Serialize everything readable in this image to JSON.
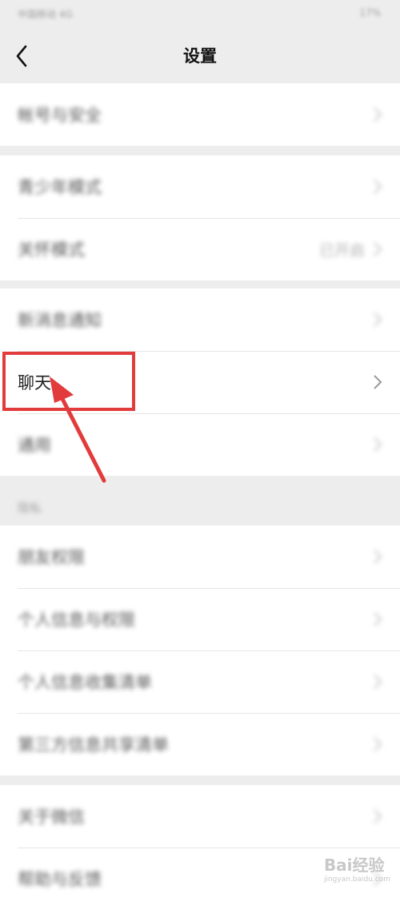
{
  "status_bar": {
    "carrier": "中国移动 4G",
    "battery": "17%"
  },
  "header": {
    "title": "设置"
  },
  "groups": [
    {
      "items": [
        {
          "label": "帐号与安全"
        }
      ]
    },
    {
      "items": [
        {
          "label": "青少年模式"
        },
        {
          "label": "关怀模式",
          "value": "已开启"
        }
      ]
    },
    {
      "items": [
        {
          "label": "新消息通知"
        },
        {
          "label": "聊天"
        },
        {
          "label": "通用"
        }
      ]
    },
    {
      "header": "隐私",
      "items": [
        {
          "label": "朋友权限"
        },
        {
          "label": "个人信息与权限"
        },
        {
          "label": "个人信息收集清单"
        },
        {
          "label": "第三方信息共享清单"
        }
      ]
    },
    {
      "items": [
        {
          "label": "关于微信"
        },
        {
          "label": "帮助与反馈"
        }
      ]
    }
  ],
  "icons": {
    "back": "chevron-left-icon",
    "row": "chevron-right-icon"
  },
  "colors": {
    "highlight": "#e23b3b",
    "background": "#ededed"
  },
  "watermark": {
    "text": "Bai经验",
    "sub": "jingyan.baidu.com"
  }
}
